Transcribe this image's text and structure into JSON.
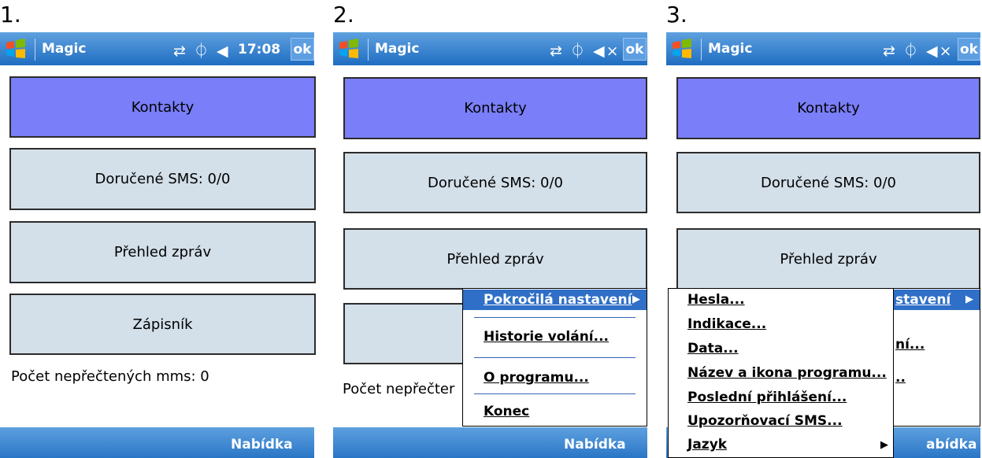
{
  "panels": [
    {
      "number": "1.",
      "title": "Magic",
      "status_icons": "⇄ ⏀ ◀",
      "clock": "17:08",
      "ok": "ok",
      "softkey": "Nabídka"
    },
    {
      "number": "2.",
      "title": "Magic",
      "status_icons": "⇄ ⏀ ◀×",
      "ok": "ok",
      "softkey": "Nabídka"
    },
    {
      "number": "3.",
      "title": "Magic",
      "status_icons": "⇄ ⏀ ◀×",
      "ok": "ok",
      "softkey": "abídka"
    }
  ],
  "tiles": {
    "contacts": "Kontakty",
    "sms": "Doručené SMS: 0/0",
    "messages": "Přehled zpráv",
    "notepad": "Zápisník"
  },
  "unread_mms": "Počet nepřečtených mms: 0",
  "unread_mms_partial": "Počet nepřečter",
  "menu": {
    "advanced": "Pokročilá nastavení",
    "history": "Historie volání...",
    "about": "O programu...",
    "quit": "Konec"
  },
  "menu_partial": {
    "advanced": "stavení",
    "history": "ní...",
    "about": ".."
  },
  "submenu": [
    "Hesla...",
    "Indikace...",
    "Data...",
    "Název a ikona programu...",
    "Poslední přihlášení...",
    "Upozorňovací SMS...",
    "Jazyk"
  ],
  "icons": [
    "windows-logo-icon",
    "sync-icon",
    "antenna-icon",
    "speaker-icon",
    "submenu-arrow-icon"
  ]
}
